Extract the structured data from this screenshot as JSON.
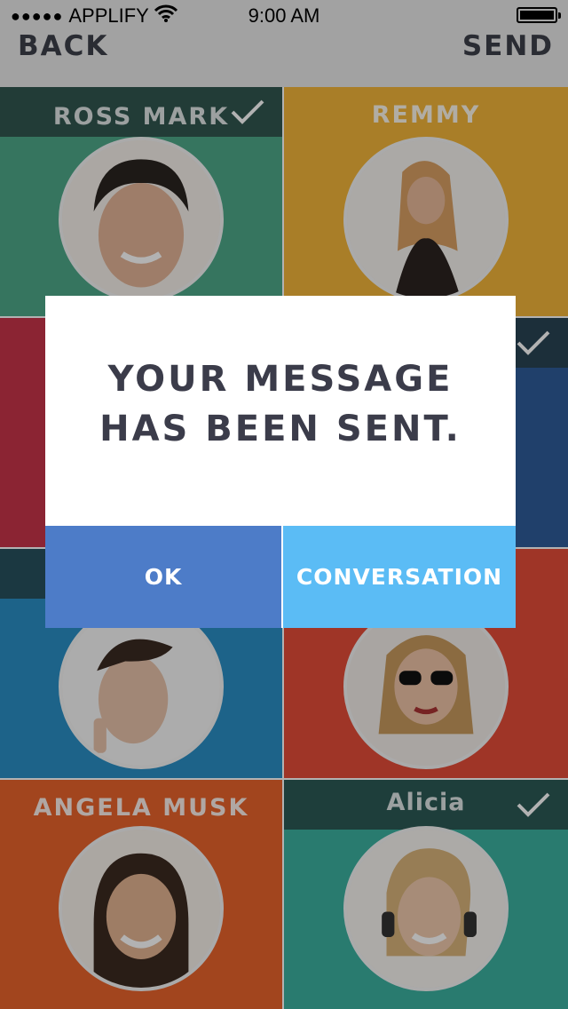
{
  "status_bar": {
    "carrier": "APPLIFY",
    "time": "9:00 AM",
    "signal_icon": "signal-dots-icon",
    "wifi_icon": "wifi-icon",
    "battery_icon": "battery-icon"
  },
  "header": {
    "back_label": "BACK",
    "send_label": "SEND"
  },
  "contacts": [
    {
      "name": "ROSS MARK",
      "color": "#4ea889",
      "selected": true
    },
    {
      "name": "REMMY",
      "color": "#f2b53a",
      "selected": false
    },
    {
      "name": "",
      "color": "#c7344a",
      "selected": false
    },
    {
      "name": "",
      "color": "#2f5c9a",
      "selected": true
    },
    {
      "name": "",
      "color": "#2a8fc4",
      "selected": true
    },
    {
      "name": "",
      "color": "#e44d39",
      "selected": false
    },
    {
      "name": "ANGELA MUSK",
      "color": "#e8632c",
      "selected": false
    },
    {
      "name": "Alicia",
      "color": "#3bb0a0",
      "selected": true
    }
  ],
  "modal": {
    "message_line1": "YOUR MESSAGE",
    "message_line2": "HAS BEEN SENT.",
    "ok_label": "OK",
    "conversation_label": "CONVERSATION",
    "ok_color": "#4d7cc8",
    "conversation_color": "#5bbcf5"
  }
}
